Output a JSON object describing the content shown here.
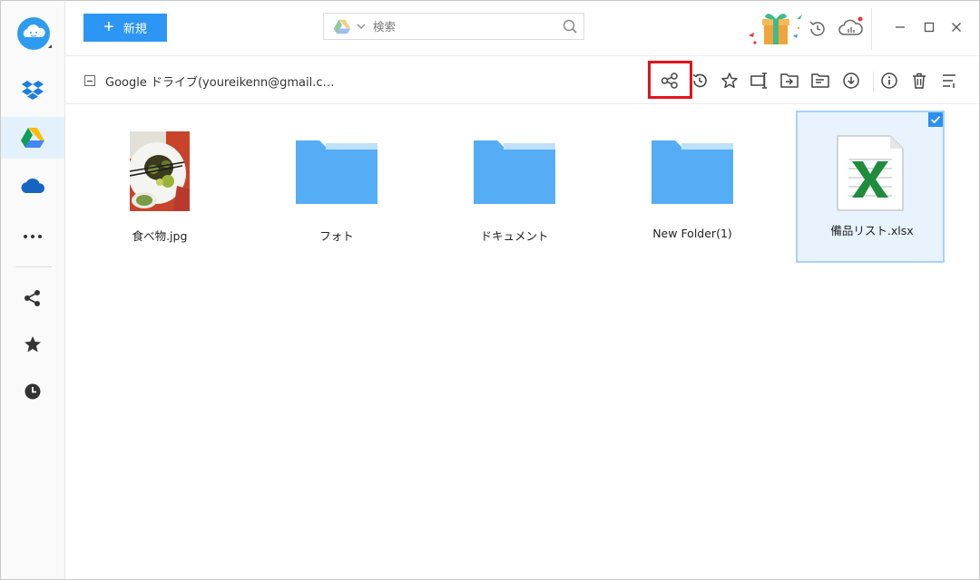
{
  "app": {
    "window_title": ""
  },
  "sidebar": {
    "items": [
      {
        "name": "dropbox",
        "icon": "dropbox-icon",
        "active": false
      },
      {
        "name": "google-drive",
        "icon": "google-drive-icon",
        "active": true
      },
      {
        "name": "onedrive",
        "icon": "onedrive-icon",
        "active": false
      },
      {
        "name": "more",
        "icon": "more-icon",
        "active": false
      },
      {
        "name": "shared",
        "icon": "share-icon",
        "active": false
      },
      {
        "name": "starred",
        "icon": "star-icon",
        "active": false
      },
      {
        "name": "recent",
        "icon": "clock-icon",
        "active": false
      }
    ]
  },
  "toolbar": {
    "new_label": "新規",
    "new_plus": "+",
    "search_placeholder": "検索"
  },
  "path": {
    "title": "Google ドライブ(youreikenn@gmail.c…"
  },
  "actions": [
    "share-icon",
    "history-icon",
    "star-icon",
    "rename-icon",
    "move-icon",
    "copy-icon",
    "download-icon",
    "info-icon",
    "delete-icon",
    "sort-icon"
  ],
  "files": [
    {
      "name": "食べ物.jpg",
      "type": "image",
      "selected": false
    },
    {
      "name": "フォト",
      "type": "folder",
      "selected": false
    },
    {
      "name": "ドキュメント",
      "type": "folder",
      "selected": false
    },
    {
      "name": "New Folder(1)",
      "type": "folder",
      "selected": false
    },
    {
      "name": "備品リスト.xlsx",
      "type": "xlsx",
      "selected": true
    }
  ],
  "colors": {
    "accent": "#2d96f4",
    "folder": "#55adf6",
    "selection_border": "#a9d2f5",
    "selection_bg": "#e8f3fd",
    "highlight": "#e0141e",
    "excel_green": "#1f8c3b"
  }
}
